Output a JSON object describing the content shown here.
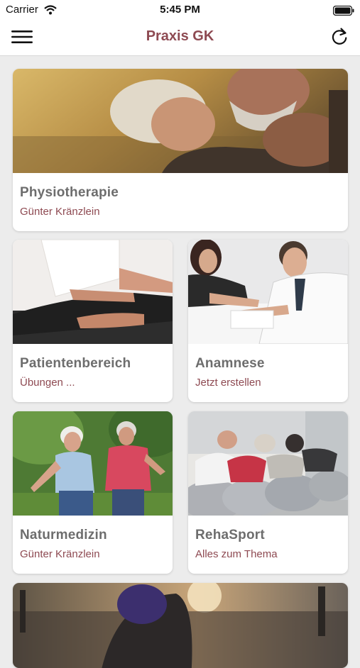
{
  "status_bar": {
    "carrier": "Carrier",
    "time": "5:45 PM"
  },
  "nav": {
    "title": "Praxis GK"
  },
  "tiles": [
    {
      "title": "Physiotherapie",
      "subtitle": "Günter Kränzlein"
    },
    {
      "title": "Patientenbereich",
      "subtitle": "Übungen ..."
    },
    {
      "title": "Anamnese",
      "subtitle": "Jetzt erstellen"
    },
    {
      "title": "Naturmedizin",
      "subtitle": "Günter Kränzlein"
    },
    {
      "title": "RehaSport",
      "subtitle": "Alles zum Thema"
    }
  ],
  "colors": {
    "accent": "#8e4a52",
    "title_gray": "#6d6d6d",
    "background": "#ececec"
  },
  "icons": {
    "menu": "hamburger-icon",
    "refresh": "refresh-icon",
    "wifi": "wifi-icon",
    "battery": "battery-icon"
  }
}
